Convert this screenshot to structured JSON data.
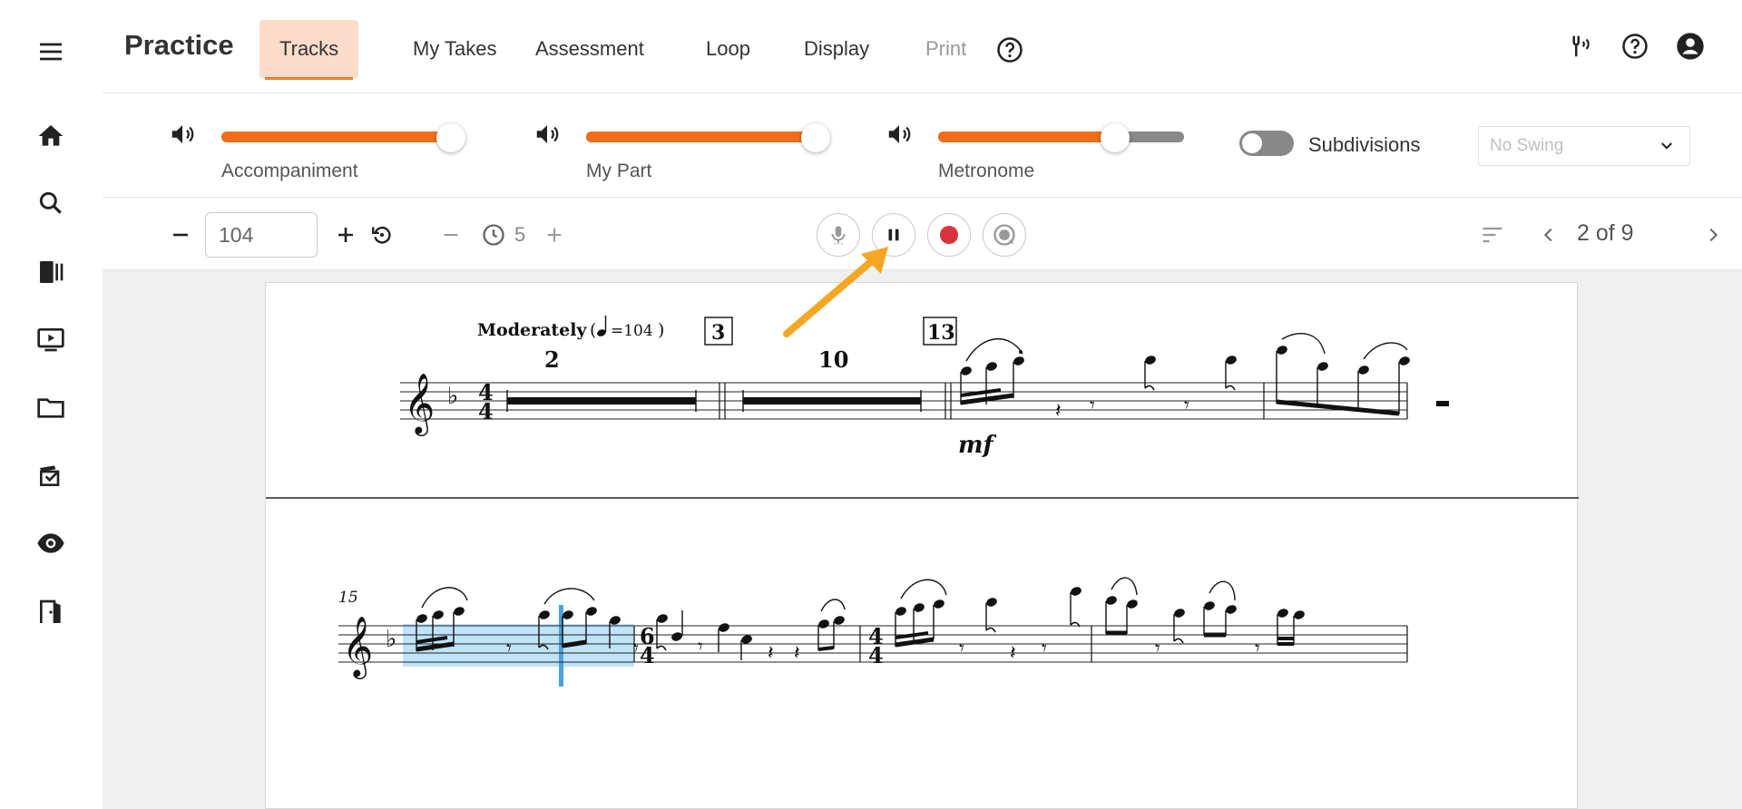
{
  "app": {
    "title": "Practice"
  },
  "nav": {
    "tabs": [
      {
        "label": "Tracks",
        "active": true
      },
      {
        "label": "My Takes"
      },
      {
        "label": "Assessment"
      },
      {
        "label": "Loop"
      },
      {
        "label": "Display"
      },
      {
        "label": "Print",
        "disabled": true
      }
    ],
    "right_icons": [
      "tuner-icon",
      "help-icon",
      "account-icon"
    ]
  },
  "sidebar": {
    "icons": [
      "menu-icon",
      "home-icon",
      "search-icon",
      "library-icon",
      "video-icon",
      "folder-icon",
      "assignment-icon",
      "view-icon",
      "exit-icon"
    ]
  },
  "mixer": {
    "accompaniment": {
      "label": "Accompaniment",
      "level": 1.0
    },
    "my_part": {
      "label": "My Part",
      "level": 1.0
    },
    "metronome": {
      "label": "Metronome",
      "level": 0.72
    },
    "subdivisions": {
      "label": "Subdivisions",
      "on": false
    },
    "swing": {
      "placeholder": "No Swing"
    }
  },
  "transport": {
    "tempo": "104",
    "count_in": "5",
    "page": "2 of 9",
    "playing": true
  },
  "score": {
    "tempo_marking": "Moderately",
    "tempo_value": "=104",
    "rehearsal_marks": [
      "3",
      "13"
    ],
    "multirest_counts": [
      "2",
      "10"
    ],
    "dynamic": "mf",
    "time_sig_start": [
      "4",
      "4"
    ],
    "system2_measure_number": "15",
    "time_sig_6_4": [
      "6",
      "4"
    ],
    "time_sig_4_4": [
      "4",
      "4"
    ]
  },
  "colors": {
    "accent": "#f06d1a",
    "active_tab_bg": "#fcdccb",
    "record": "#d9323f",
    "highlight": "#bfe3f7",
    "annotation_arrow": "#f5a623"
  }
}
